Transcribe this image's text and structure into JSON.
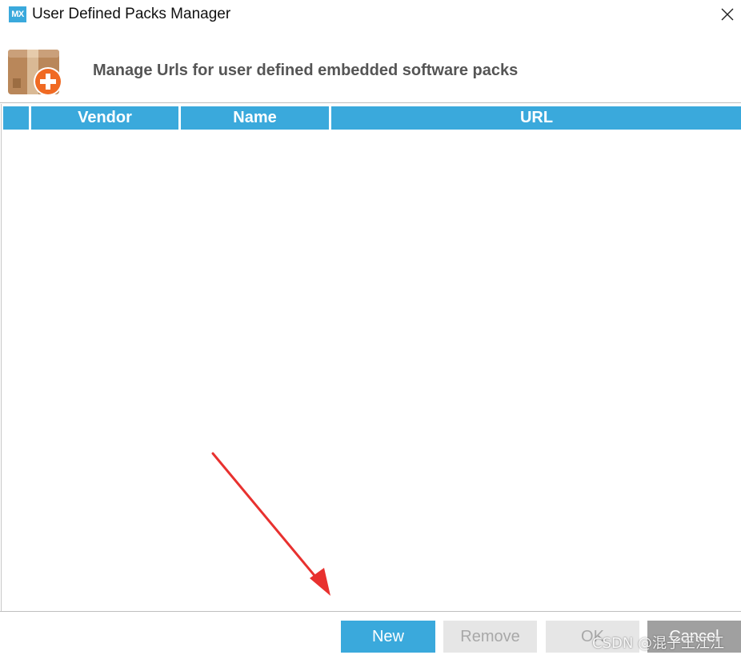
{
  "window": {
    "app_icon_text": "MX",
    "title": "User Defined Packs Manager"
  },
  "header": {
    "text": "Manage Urls for user defined embedded software packs"
  },
  "table": {
    "columns": [
      "",
      "Vendor",
      "Name",
      "URL"
    ],
    "rows": []
  },
  "buttons": {
    "new": "New",
    "remove": "Remove",
    "ok": "OK",
    "cancel": "Cancel"
  },
  "watermark": "CSDN @混子王江江",
  "colors": {
    "accent": "#3aa9dc",
    "disabled_bg": "#e6e6e6",
    "disabled_text": "#a8a8a8",
    "annotation_arrow": "#e8312f"
  }
}
